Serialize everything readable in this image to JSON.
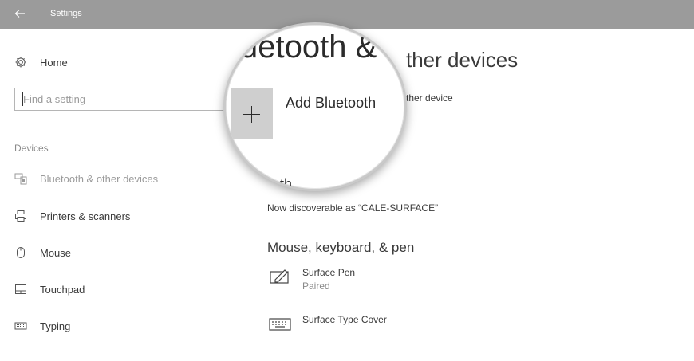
{
  "window": {
    "title": "Settings"
  },
  "sidebar": {
    "home_label": "Home",
    "search_placeholder": "Find a setting",
    "section": "Devices",
    "items": [
      {
        "label": "Bluetooth & other devices",
        "icon": "bluetooth-devices-icon",
        "selected": true
      },
      {
        "label": "Printers & scanners",
        "icon": "printer-icon"
      },
      {
        "label": "Mouse",
        "icon": "mouse-icon"
      },
      {
        "label": "Touchpad",
        "icon": "touchpad-icon"
      },
      {
        "label": "Typing",
        "icon": "keyboard-icon"
      }
    ]
  },
  "main": {
    "title_partial": "ther devices",
    "add_partial": "ther device",
    "discoverable": "Now discoverable as “CALE-SURFACE”",
    "mouse_section": "Mouse, keyboard, & pen",
    "devices": [
      {
        "name": "Surface Pen",
        "status": "Paired",
        "icon": "pen-icon"
      },
      {
        "name": "Surface Type Cover",
        "status": "",
        "icon": "keyboard-icon"
      }
    ]
  },
  "magnifier": {
    "title_fragment": "uetooth &",
    "add_label": "Add Bluetooth",
    "bottom_fragment": "th"
  },
  "colors": {
    "titlebar": "#9b9b9b",
    "plus_tile": "#cfcfcf"
  }
}
